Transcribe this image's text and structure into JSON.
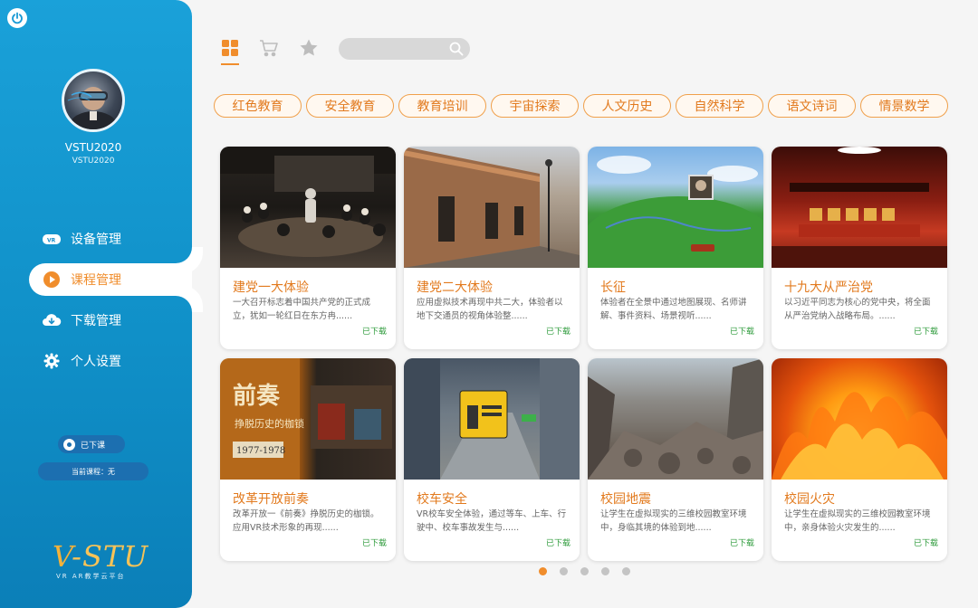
{
  "user": {
    "name": "VSTU2020",
    "id": "VSTU2020"
  },
  "menu": [
    {
      "label": "设备管理",
      "icon": "vr-headset-icon",
      "active": false
    },
    {
      "label": "课程管理",
      "icon": "play-icon",
      "active": true
    },
    {
      "label": "下载管理",
      "icon": "cloud-download-icon",
      "active": false
    },
    {
      "label": "个人设置",
      "icon": "gear-icon",
      "active": false
    }
  ],
  "status": {
    "class_state": "已下课",
    "current_course": "当前课程：无"
  },
  "brand": {
    "logo_v": "V",
    "logo_rest": "-STU",
    "tagline": "VR AR教学云平台"
  },
  "search": {
    "placeholder": ""
  },
  "categories": [
    "红色教育",
    "安全教育",
    "教育培训",
    "宇宙探索",
    "人文历史",
    "自然科学",
    "语文诗词",
    "情景数学"
  ],
  "courses": [
    {
      "title": "建党一大体验",
      "desc": "一大召开标志着中国共产党的正式成立，犹如一轮红日在东方冉......",
      "status": "已下载"
    },
    {
      "title": "建党二大体验",
      "desc": "应用虚拟技术再现中共二大，体验者以地下交通员的视角体验整......",
      "status": "已下载"
    },
    {
      "title": "长征",
      "desc": "体验者在全景中通过地图展现、名师讲解、事件资料、场景视听......",
      "status": "已下载"
    },
    {
      "title": "十九大从严治党",
      "desc": "以习近平同志为核心的党中央，将全面从严治党纳入战略布局。......",
      "status": "已下载"
    },
    {
      "title": "改革开放前奏",
      "desc": "改革开放一《前奏》挣脱历史的枷锁。应用VR技术形象的再现......",
      "status": "已下载"
    },
    {
      "title": "校车安全",
      "desc": "VR校车安全体验，通过等车、上车、行驶中、校车事故发生与......",
      "status": "已下载"
    },
    {
      "title": "校园地震",
      "desc": "让学生在虚拟现实的三维校园教室环境中，身临其境的体验到地......",
      "status": "已下载"
    },
    {
      "title": "校园火灾",
      "desc": "让学生在虚拟现实的三维校园教室环境中，亲身体验火灾发生的......",
      "status": "已下载"
    }
  ],
  "image_text": {
    "qianzou_title": "前奏",
    "qianzou_sub": "挣脱历史的枷锁",
    "qianzou_years": "1977-1978"
  },
  "pagination": {
    "pages": 5,
    "current": 1
  },
  "colors": {
    "accent": "#f08d2c",
    "sidebar": "#1090c8",
    "downloaded": "#2c9a3a"
  }
}
